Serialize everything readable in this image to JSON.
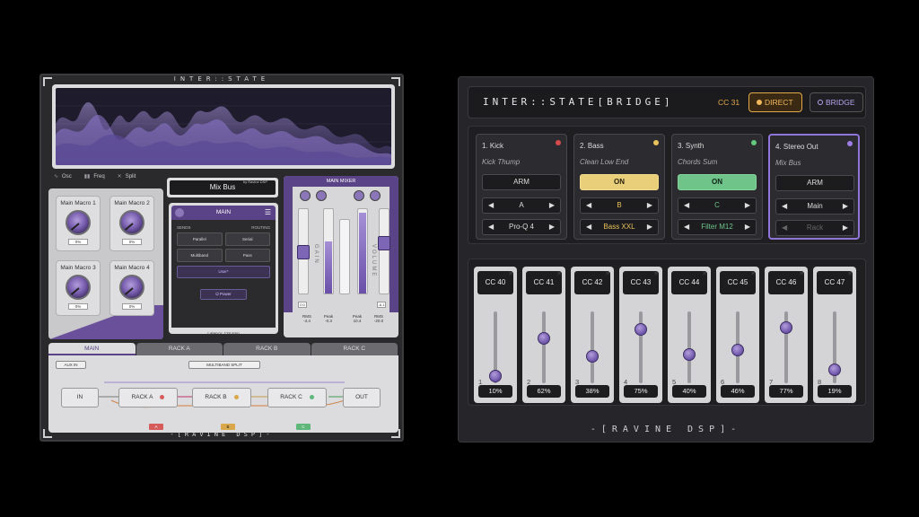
{
  "left_plugin": {
    "title": "INTER::STATE",
    "footer": "-[RAVINE DSP]-",
    "view_options": [
      {
        "icon": "wave-icon",
        "label": "Osc"
      },
      {
        "icon": "bars-icon",
        "label": "Freq"
      },
      {
        "icon": "split-icon",
        "label": "Split"
      }
    ],
    "macros": [
      {
        "label": "Main Macro 1",
        "value": "0%"
      },
      {
        "label": "Main Macro 2",
        "value": "0%"
      },
      {
        "label": "Main Macro 3",
        "value": "0%"
      },
      {
        "label": "Main Macro 4",
        "value": "0%"
      }
    ],
    "bus_name": "Mix Bus",
    "by_label": "by Ravine DSP",
    "main_panel": {
      "title": "MAIN",
      "sends_label": "SENDS",
      "routing_label": "ROUTING",
      "buttons": [
        "Parallel",
        "Serial",
        "Multiband",
        "Pass"
      ],
      "user_button": "User*",
      "power_label": "Power",
      "latency": "Latency: 118 smp"
    },
    "mixer": {
      "title": "MAIN MIXER",
      "gain_label": "GAIN",
      "volume_label": "VOLUME",
      "gain_box": "0.0",
      "volume_box": "-6.1",
      "readouts": [
        {
          "label": "RMS",
          "value": "-4.4"
        },
        {
          "label": "Peak",
          "value": "-0.3"
        },
        {
          "label": "Peak",
          "value": "10.4"
        },
        {
          "label": "RMS",
          "value": "-20.0"
        }
      ]
    },
    "tabs": [
      "MAIN",
      "RACK A",
      "RACK B",
      "RACK C"
    ],
    "active_tab": "MAIN",
    "routing": {
      "aux_in": "AUX IN",
      "multiband_split": "MULTIBAND SPLIT",
      "nodes": [
        "IN",
        "RACK A",
        "RACK B",
        "RACK C",
        "OUT"
      ],
      "swatches": [
        {
          "label": "A",
          "color": "#d65c5c"
        },
        {
          "label": "B",
          "color": "#d9a84a"
        },
        {
          "label": "C",
          "color": "#5fb77a"
        }
      ]
    }
  },
  "right_plugin": {
    "title": "INTER::STATE[BRIDGE]",
    "cc_label": "CC 31",
    "direct_label": "DIRECT",
    "bridge_label": "BRIDGE",
    "footer": "-[RAVINE DSP]-",
    "tracks": [
      {
        "name": "1. Kick",
        "sub": "Kick Thump",
        "button": "ARM",
        "select": "A",
        "plugin": "Pro-Q 4",
        "led": "#d64b4b"
      },
      {
        "name": "2. Bass",
        "sub": "Clean Low End",
        "button": "ON",
        "select": "B",
        "plugin": "Bass XXL",
        "led": "#e8c25a"
      },
      {
        "name": "3. Synth",
        "sub": "Chords Sum",
        "button": "ON",
        "select": "C",
        "plugin": "Filter M12",
        "led": "#63c67c"
      },
      {
        "name": "4. Stereo Out",
        "sub": "Mix Bus",
        "button": "ARM",
        "select": "Main",
        "plugin": "Rack",
        "led": "#9a7ee6"
      }
    ],
    "cc_sliders": [
      {
        "label": "CC 40",
        "index": "1",
        "percent": "10%",
        "value": 0.1
      },
      {
        "label": "CC 41",
        "index": "2",
        "percent": "62%",
        "value": 0.62
      },
      {
        "label": "CC 42",
        "index": "3",
        "percent": "38%",
        "value": 0.38
      },
      {
        "label": "CC 43",
        "index": "4",
        "percent": "75%",
        "value": 0.75
      },
      {
        "label": "CC 44",
        "index": "5",
        "percent": "40%",
        "value": 0.4
      },
      {
        "label": "CC 45",
        "index": "6",
        "percent": "46%",
        "value": 0.46
      },
      {
        "label": "CC 46",
        "index": "7",
        "percent": "77%",
        "value": 0.77
      },
      {
        "label": "CC 47",
        "index": "8",
        "percent": "19%",
        "value": 0.19
      }
    ]
  }
}
